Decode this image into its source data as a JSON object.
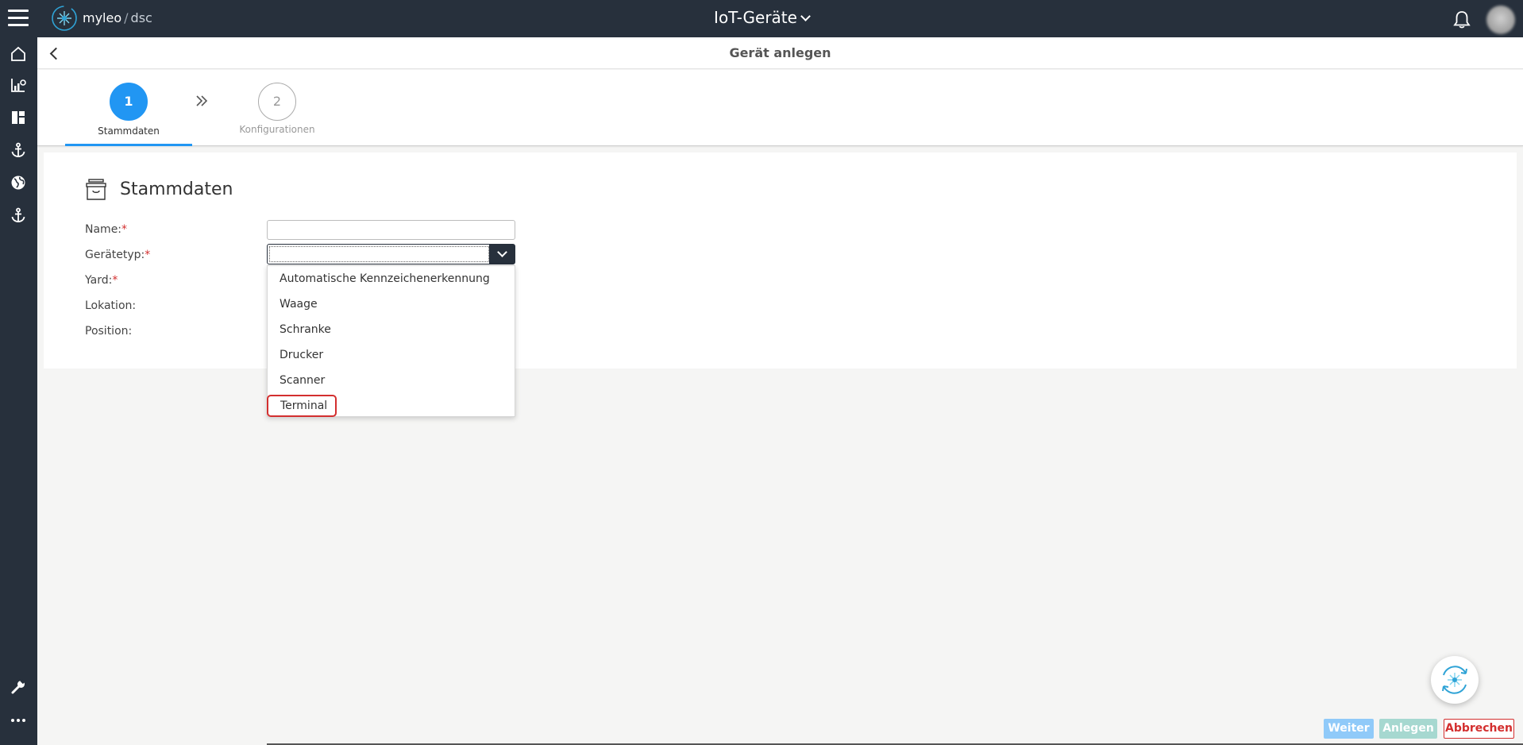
{
  "topbar": {
    "logo_name": "myleo",
    "logo_sep": "/",
    "logo_sub": "dsc",
    "app_title": "IoT-Geräte"
  },
  "sidebar": {
    "items": [
      {
        "icon": "home-icon"
      },
      {
        "icon": "chart-icon"
      },
      {
        "icon": "dashboard-icon"
      },
      {
        "icon": "anchor-icon"
      },
      {
        "icon": "globe-icon"
      },
      {
        "icon": "anchor-icon"
      },
      {
        "icon": "wrench-icon"
      },
      {
        "icon": "more-icon"
      }
    ]
  },
  "subheader": {
    "title": "Gerät anlegen"
  },
  "stepper": {
    "steps": [
      {
        "number": "1",
        "label": "Stammdaten",
        "active": true
      },
      {
        "number": "2",
        "label": "Konfigurationen",
        "active": false
      }
    ]
  },
  "form": {
    "title": "Stammdaten",
    "fields": {
      "name": {
        "label": "Name:",
        "required": "*",
        "value": ""
      },
      "geraetetyp": {
        "label": "Gerätetyp:",
        "required": "*",
        "value": ""
      },
      "yard": {
        "label": "Yard:",
        "required": "*"
      },
      "lokation": {
        "label": "Lokation:"
      },
      "position": {
        "label": "Position:"
      }
    }
  },
  "dropdown": {
    "options": [
      "Automatische Kennzeichenerkennung",
      "Waage",
      "Schranke",
      "Drucker",
      "Scanner",
      "Terminal"
    ],
    "highlighted": "Terminal"
  },
  "actions": {
    "weiter": "Weiter",
    "anlegen": "Anlegen",
    "abbrechen": "Abbrechen"
  },
  "colors": {
    "nav_bg": "#27303c",
    "primary": "#2196f3",
    "danger": "#d32f2f"
  }
}
